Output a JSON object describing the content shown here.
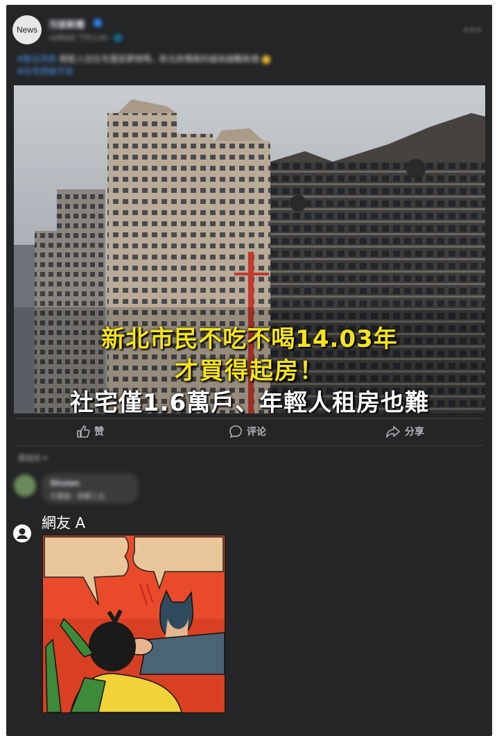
{
  "post": {
    "avatar_text": "News",
    "page_name": "污拔新聞",
    "time": "10月9日 下午2:45 · 🌐",
    "more_icon": "more-horizontal-icon",
    "caption_line1_tag": "#新北市民",
    "caption_line1": " 輕鬆入住社宅還是夢想嗎，新北房價真的越來越難負擔",
    "caption_line2": "#社宅供給不足"
  },
  "image": {
    "headline_line1": "新北市民不吃不喝14.03年",
    "headline_line2": "才買得起房！",
    "headline_line3": "社宅僅1.6萬戶、年輕人租房也難"
  },
  "actions": {
    "like_label": "赞",
    "comment_label": "评论",
    "share_label": "分享"
  },
  "comments": {
    "sort_label": "最相关 ▾",
    "first": {
      "name": "Shuian",
      "text": "不要跳 · 想要三五"
    },
    "second": {
      "name": "網友 A"
    }
  },
  "colors": {
    "post_bg": "#242526",
    "headline_yellow": "#f5e41a",
    "text_secondary": "#b0b3b8"
  }
}
